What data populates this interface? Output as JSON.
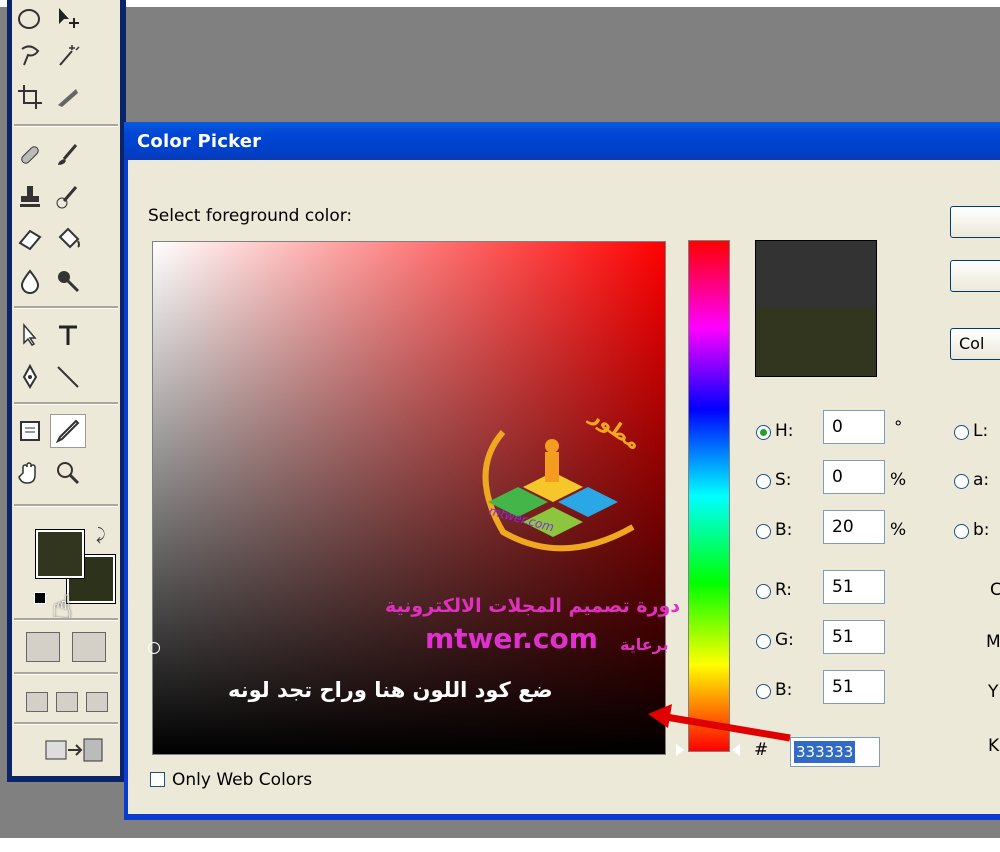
{
  "dialog": {
    "title": "Color Picker",
    "prompt": "Select foreground color:",
    "only_web_colors": "Only Web Colors",
    "partial_button": "Col"
  },
  "hsb": {
    "h": {
      "label": "H:",
      "value": "0",
      "unit": "°"
    },
    "s": {
      "label": "S:",
      "value": "0",
      "unit": "%"
    },
    "b": {
      "label": "B:",
      "value": "20",
      "unit": "%"
    }
  },
  "rgb": {
    "r": {
      "label": "R:",
      "value": "51"
    },
    "g": {
      "label": "G:",
      "value": "51"
    },
    "b": {
      "label": "B:",
      "value": "51"
    }
  },
  "lab": {
    "l": "L:",
    "a": "a:",
    "b": "b:"
  },
  "cmyk": {
    "c": "C",
    "m": "M",
    "y": "Y",
    "k": "K"
  },
  "hex": {
    "symbol": "#",
    "value": "333333"
  },
  "colors": {
    "new": "#333333",
    "current": "#33361f",
    "title_bar": "#0046d5",
    "accent": "#ff0000"
  },
  "watermark": {
    "course": "دورة تصميم المجلات الالكترونية",
    "site": "mtwer.com",
    "sponsor": "برعاية",
    "logo_text": "مطور",
    "logo_url": "mtwer.com"
  },
  "annotation": "ضع كود اللون هنا وراح تجد لونه"
}
